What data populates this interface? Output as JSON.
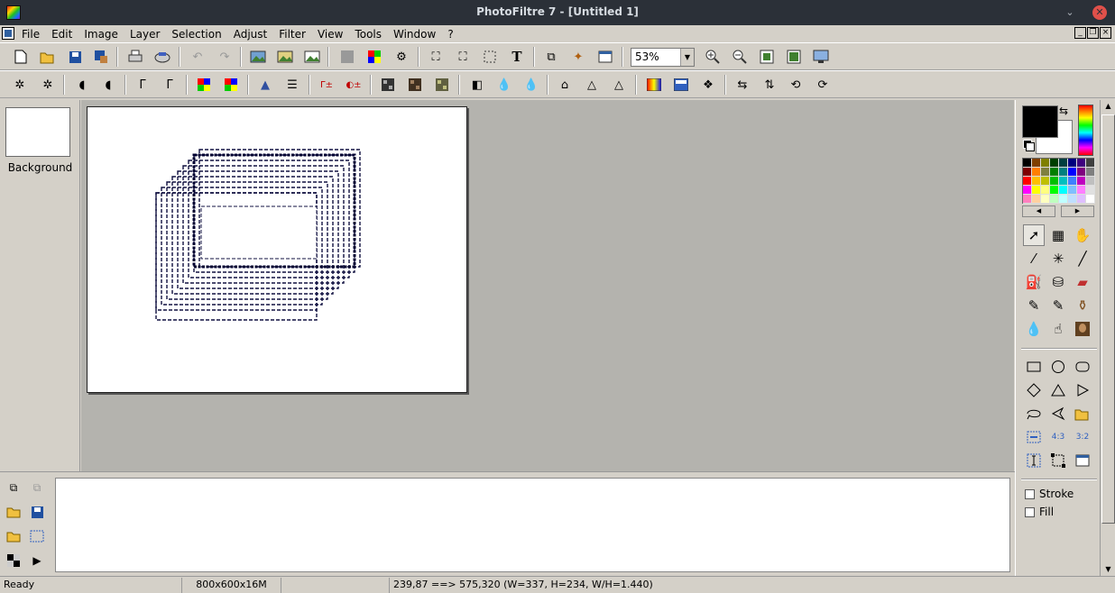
{
  "window": {
    "title": "PhotoFiltre 7 - [Untitled 1]",
    "min_glyph": "⌄",
    "close_glyph": "✕"
  },
  "menu": {
    "items": [
      "File",
      "Edit",
      "Image",
      "Layer",
      "Selection",
      "Adjust",
      "Filter",
      "View",
      "Tools",
      "Window",
      "?"
    ]
  },
  "toolbar": {
    "zoom_value": "53%"
  },
  "layers": {
    "items": [
      {
        "name": "Background"
      }
    ]
  },
  "palette": {
    "foreground_color": "#000000",
    "background_color": "#ffffff",
    "swatches": [
      "#000000",
      "#7f3f00",
      "#7f7f00",
      "#003f00",
      "#003f3f",
      "#00007f",
      "#3f007f",
      "#3f3f3f",
      "#7f0000",
      "#ff7f00",
      "#7f7f3f",
      "#007f00",
      "#007f7f",
      "#0000ff",
      "#7f007f",
      "#7f7f7f",
      "#ff0000",
      "#ffbf00",
      "#bfbf00",
      "#00bf00",
      "#00bfbf",
      "#3f7fff",
      "#bf00bf",
      "#bfbfbf",
      "#ff00ff",
      "#ffff00",
      "#ffff7f",
      "#00ff00",
      "#00ffff",
      "#7fbfff",
      "#ff7fff",
      "#e0e0e0",
      "#ff7fbf",
      "#ffd0a0",
      "#ffffbf",
      "#bfffbf",
      "#bfffff",
      "#bfdfff",
      "#dfbfff",
      "#ffffff"
    ],
    "stroke_label": "Stroke",
    "fill_label": "Fill",
    "stroke_checked": false,
    "fill_checked": false
  },
  "status": {
    "state": "Ready",
    "image_info": "800x600x16M",
    "selection_info": "",
    "coords": "239,87 ==> 575,320 (W=337, H=234, W/H=1.440)"
  },
  "scrollbar": {
    "up_glyph": "▲",
    "down_glyph": "▼"
  }
}
